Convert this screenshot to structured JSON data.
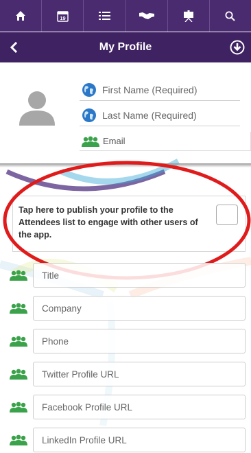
{
  "topnav": {
    "tabs": [
      {
        "name": "home-icon"
      },
      {
        "name": "calendar-icon",
        "day": "19"
      },
      {
        "name": "list-icon"
      },
      {
        "name": "handshake-icon"
      },
      {
        "name": "presentation-icon"
      },
      {
        "name": "search-icon"
      }
    ]
  },
  "header": {
    "title": "My Profile"
  },
  "profile": {
    "first_name_placeholder": "First Name (Required)",
    "last_name_placeholder": "Last Name (Required)",
    "email_label": "Email"
  },
  "publish": {
    "message": "Tap here to publish your profile to the Attendees list to engage with other users of the app."
  },
  "fields": [
    {
      "placeholder": "Title"
    },
    {
      "placeholder": "Company"
    },
    {
      "placeholder": "Phone"
    },
    {
      "placeholder": "Twitter Profile URL"
    },
    {
      "placeholder": "Facebook Profile URL"
    },
    {
      "placeholder": "LinkedIn Profile URL"
    }
  ],
  "colors": {
    "nav_bg": "#4a2b6f",
    "header_bg": "#3f2262",
    "globe_icon": "#2b78c8",
    "people_icon": "#3aa24a",
    "annotation": "#e01b1b"
  }
}
